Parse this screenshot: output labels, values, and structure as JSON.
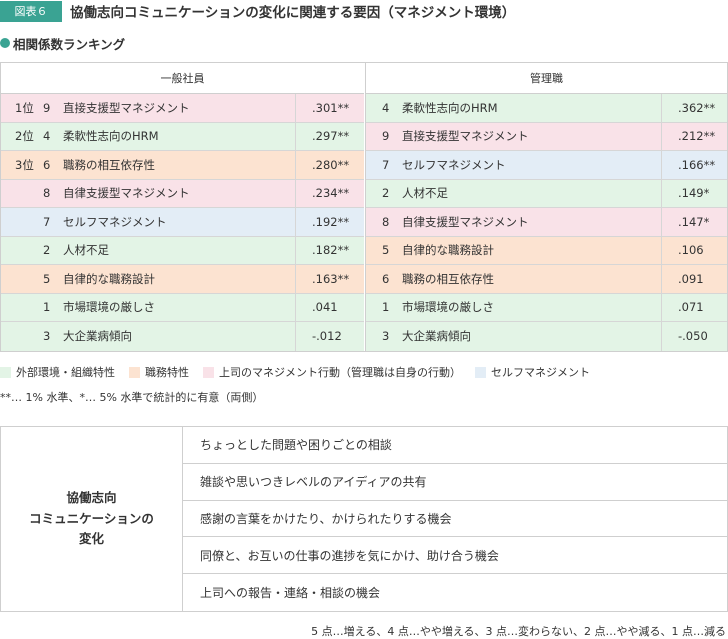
{
  "header": {
    "badge": "図表６",
    "title": "協働志向コミュニケーションの変化に関連する要因（マネジメント環境）"
  },
  "subtitle": "相関係数ランキング",
  "colors": {
    "accent": "#3aa393",
    "external": "#e3f4e6",
    "job": "#fce3d1",
    "boss": "#f9e2e8",
    "self": "#e3edf6"
  },
  "ranking": {
    "left": {
      "header": "一般社員",
      "rows": [
        {
          "rank": "1位",
          "num": "9",
          "label": "直接支援型マネジメント",
          "value": ".301**",
          "cat": "boss"
        },
        {
          "rank": "2位",
          "num": "4",
          "label": "柔軟性志向のHRM",
          "value": ".297**",
          "cat": "external"
        },
        {
          "rank": "3位",
          "num": "6",
          "label": "職務の相互依存性",
          "value": ".280**",
          "cat": "job"
        },
        {
          "rank": "",
          "num": "8",
          "label": "自律支援型マネジメント",
          "value": ".234**",
          "cat": "boss"
        },
        {
          "rank": "",
          "num": "7",
          "label": "セルフマネジメント",
          "value": ".192**",
          "cat": "self"
        },
        {
          "rank": "",
          "num": "2",
          "label": "人材不足",
          "value": ".182**",
          "cat": "external"
        },
        {
          "rank": "",
          "num": "5",
          "label": "自律的な職務設計",
          "value": ".163**",
          "cat": "job"
        },
        {
          "rank": "",
          "num": "1",
          "label": "市場環境の厳しさ",
          "value": ".041",
          "cat": "external"
        },
        {
          "rank": "",
          "num": "3",
          "label": "大企業病傾向",
          "value": "-.012",
          "cat": "external"
        }
      ]
    },
    "right": {
      "header": "管理職",
      "rows": [
        {
          "num": "4",
          "label": "柔軟性志向のHRM",
          "value": ".362**",
          "cat": "external"
        },
        {
          "num": "9",
          "label": "直接支援型マネジメント",
          "value": ".212**",
          "cat": "boss"
        },
        {
          "num": "7",
          "label": "セルフマネジメント",
          "value": ".166**",
          "cat": "self"
        },
        {
          "num": "2",
          "label": "人材不足",
          "value": ".149*",
          "cat": "external"
        },
        {
          "num": "8",
          "label": "自律支援型マネジメント",
          "value": ".147*",
          "cat": "boss"
        },
        {
          "num": "5",
          "label": "自律的な職務設計",
          "value": ".106",
          "cat": "job"
        },
        {
          "num": "6",
          "label": "職務の相互依存性",
          "value": ".091",
          "cat": "job"
        },
        {
          "num": "1",
          "label": "市場環境の厳しさ",
          "value": ".071",
          "cat": "external"
        },
        {
          "num": "3",
          "label": "大企業病傾向",
          "value": "-.050",
          "cat": "external"
        }
      ]
    }
  },
  "legend": [
    {
      "label": "外部環境・組織特性",
      "cat": "external"
    },
    {
      "label": "職務特性",
      "cat": "job"
    },
    {
      "label": "上司のマネジメント行動（管理職は自身の行動）",
      "cat": "boss"
    },
    {
      "label": "セルフマネジメント",
      "cat": "self"
    }
  ],
  "note": "**… 1% 水準、*… 5% 水準で統計的に有意（両側）",
  "change": {
    "label_lines": [
      "協働志向",
      "コミュニケーションの",
      "変化"
    ],
    "items": [
      "ちょっとした問題や困りごとの相談",
      "雑談や思いつきレベルのアイディアの共有",
      "感謝の言葉をかけたり、かけられたりする機会",
      "同僚と、お互いの仕事の進捗を気にかけ、助け合う機会",
      "上司への報告・連絡・相談の機会"
    ]
  },
  "footnote": "5 点…増える、4 点…やや増える、3 点…変わらない、2 点…やや減る、1 点…減る"
}
